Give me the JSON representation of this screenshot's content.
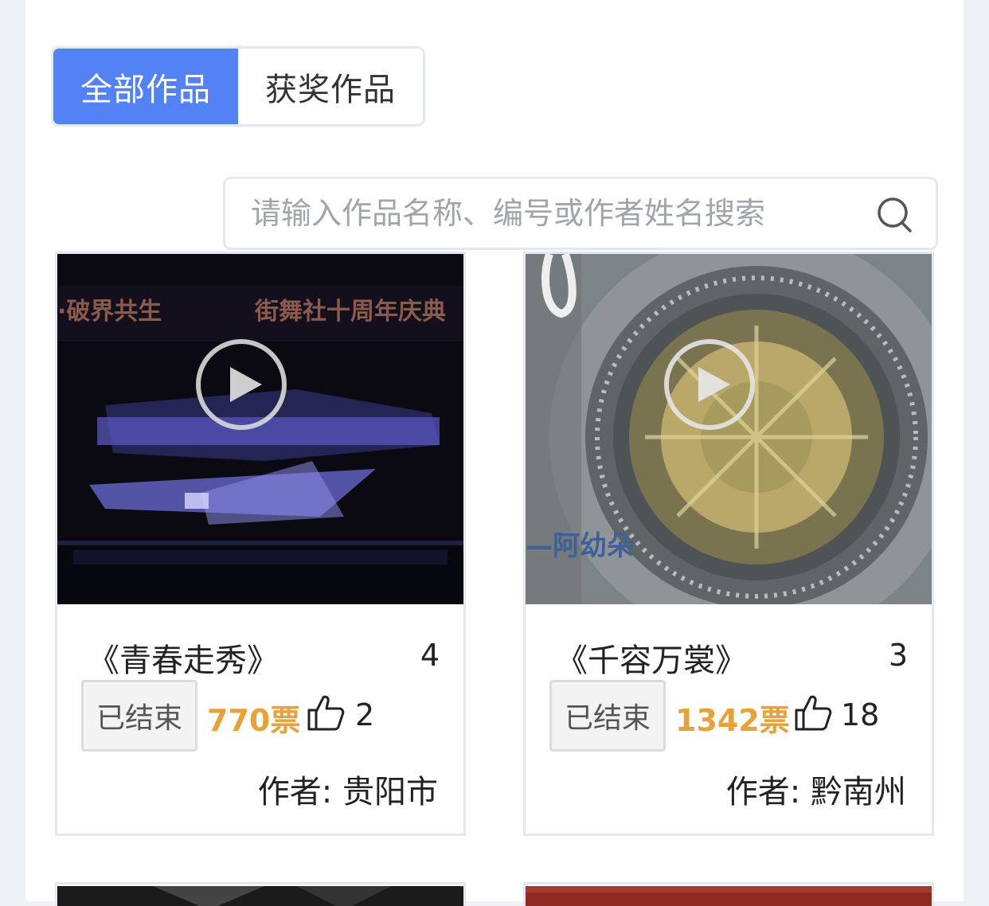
{
  "tabs": [
    {
      "label": "全部作品",
      "active": true
    },
    {
      "label": "获奖作品",
      "active": false
    }
  ],
  "search": {
    "placeholder": "请输入作品名称、编号或作者姓名搜索",
    "icon": "search-icon"
  },
  "colors": {
    "accent": "#5282f5",
    "votes": "#e8a23c",
    "border": "#e3e8f0"
  },
  "works": [
    {
      "title": "《青春走秀》",
      "number": "4",
      "status": "已结束",
      "votes": "770票",
      "likes": "2",
      "author": "作者: 贵阳市",
      "thumbnail_icon": "play-icon",
      "thumbnail_text": [
        "·破界共生",
        "街舞社十周年庆典"
      ]
    },
    {
      "title": "《千容万裳》",
      "number": "3",
      "status": "已结束",
      "votes": "1342票",
      "likes": "18",
      "author": "作者: 黔南州",
      "thumbnail_icon": "play-icon",
      "thumbnail_text": [
        "—阿幼朵"
      ]
    }
  ]
}
